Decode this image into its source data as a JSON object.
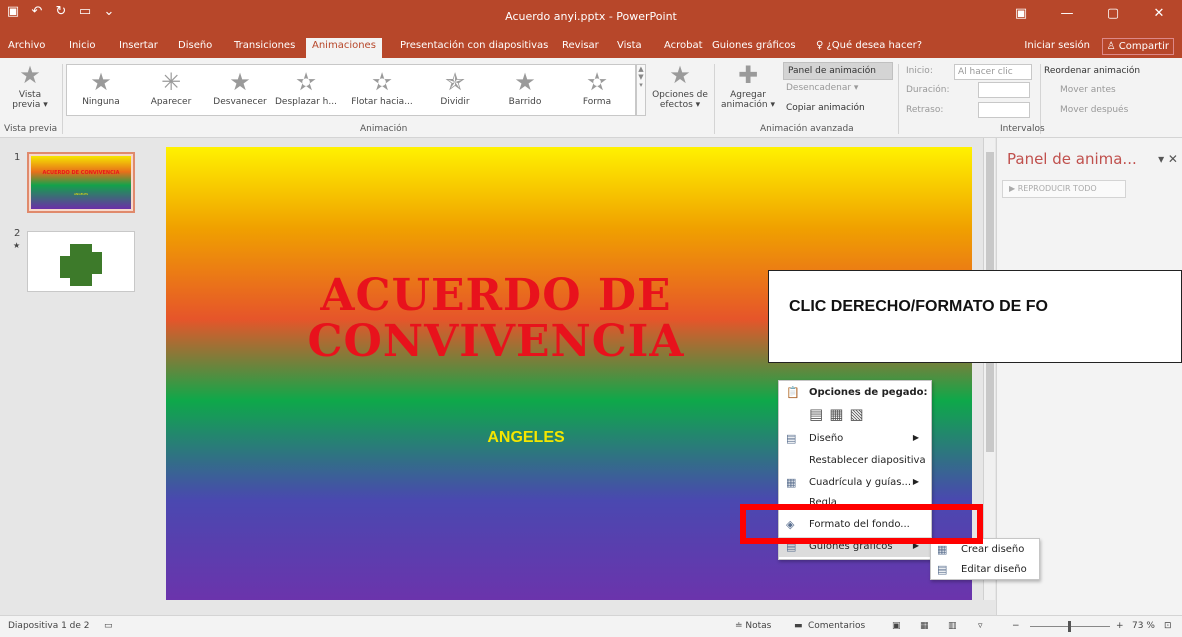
{
  "window": {
    "title": "Acuerdo anyi.pptx - PowerPoint",
    "qat": [
      "▣",
      "↶",
      "↻",
      "▭",
      "⌄"
    ],
    "controls": [
      "▣",
      "—",
      "▢",
      "✕"
    ]
  },
  "menu": {
    "tabs": [
      "Archivo",
      "Inicio",
      "Insertar",
      "Diseño",
      "Transiciones",
      "Animaciones",
      "Presentación con diapositivas",
      "Revisar",
      "Vista",
      "Acrobat",
      "Guiones gráficos"
    ],
    "active_tab": "Animaciones",
    "tell_me": "♀ ¿Qué desea hacer?",
    "sign_in": "Iniciar sesión",
    "share": "Compartir"
  },
  "ribbon": {
    "preview_label": "Vista previa ▾",
    "preview_group": "Vista previa",
    "animations": [
      "Ninguna",
      "Aparecer",
      "Desvanecer",
      "Desplazar h...",
      "Flotar hacia...",
      "Dividir",
      "Barrido",
      "Forma"
    ],
    "effect_options": "Opciones de efectos ▾",
    "animation_group": "Animación",
    "add_animation": "Agregar animación ▾",
    "animation_pane": "Panel de animación",
    "trigger": "Desencadenar ▾",
    "copy_animation": "Copiar animación",
    "advanced_group": "Animación avanzada",
    "start_label": "Inicio:",
    "start_value": "Al hacer clic",
    "duration_label": "Duración:",
    "delay_label": "Retraso:",
    "reorder": "Reordenar animación",
    "move_earlier": "Mover antes",
    "move_later": "Mover después",
    "timing_group": "Intervalos"
  },
  "thumbnails": [
    {
      "num": "1",
      "title": "ACUERDO DE CONVIVENCIA",
      "subtitle": "ANGELES"
    },
    {
      "num": "2",
      "star": "★"
    }
  ],
  "slide": {
    "title": "ACUERDO DE CONVIVENCIA",
    "subtitle": "ANGELES"
  },
  "anim_pane": {
    "title": "Panel de anima...",
    "play_all": "▶ REPRODUCIR TODO"
  },
  "callout": "CLIC DERECHO/FORMATO DE FO",
  "context_menu": {
    "paste_header": "Opciones de pegado:",
    "items": [
      "Diseño",
      "Restablecer diapositiva",
      "Cuadrícula y guías...",
      "Regla",
      "Formato del fondo...",
      "Guiones gráficos"
    ]
  },
  "submenu": [
    "Crear diseño",
    "Editar diseño"
  ],
  "status": {
    "slide": "Diapositiva 1 de 2",
    "notes": "≐ Notas",
    "comments": "Comentarios",
    "zoom": "73 %"
  }
}
